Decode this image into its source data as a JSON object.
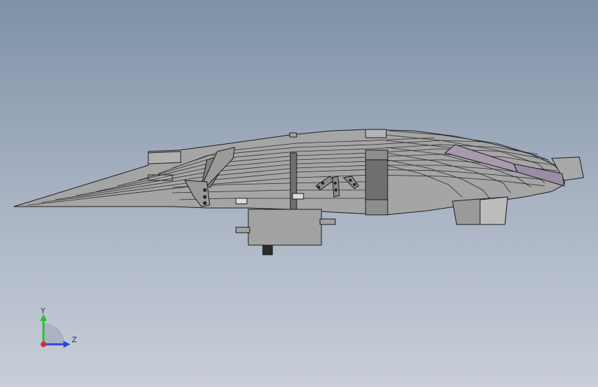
{
  "viewport": {
    "background_top": "#7e91a6",
    "background_bottom": "#c9ced9",
    "model_fill": "#a5a5a5",
    "model_edge": "#1a1a1a",
    "accent_purple": "#a79aae"
  },
  "triad": {
    "y_label": "Y",
    "z_label": "Z",
    "y_color": "#2fbf2f",
    "z_color": "#2f46d6",
    "x_color": "#d62f2f"
  }
}
